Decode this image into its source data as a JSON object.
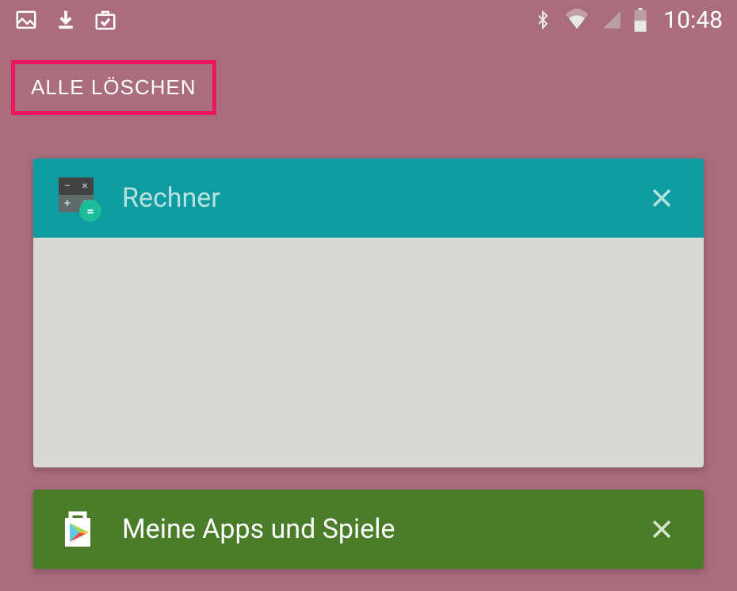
{
  "status_bar": {
    "time": "10:48"
  },
  "clear_all": {
    "label": "ALLE LÖSCHEN"
  },
  "cards": [
    {
      "title": "Rechner",
      "color": "teal",
      "icon": "calculator"
    },
    {
      "title": "Meine Apps und Spiele",
      "color": "green",
      "icon": "play-store"
    }
  ]
}
